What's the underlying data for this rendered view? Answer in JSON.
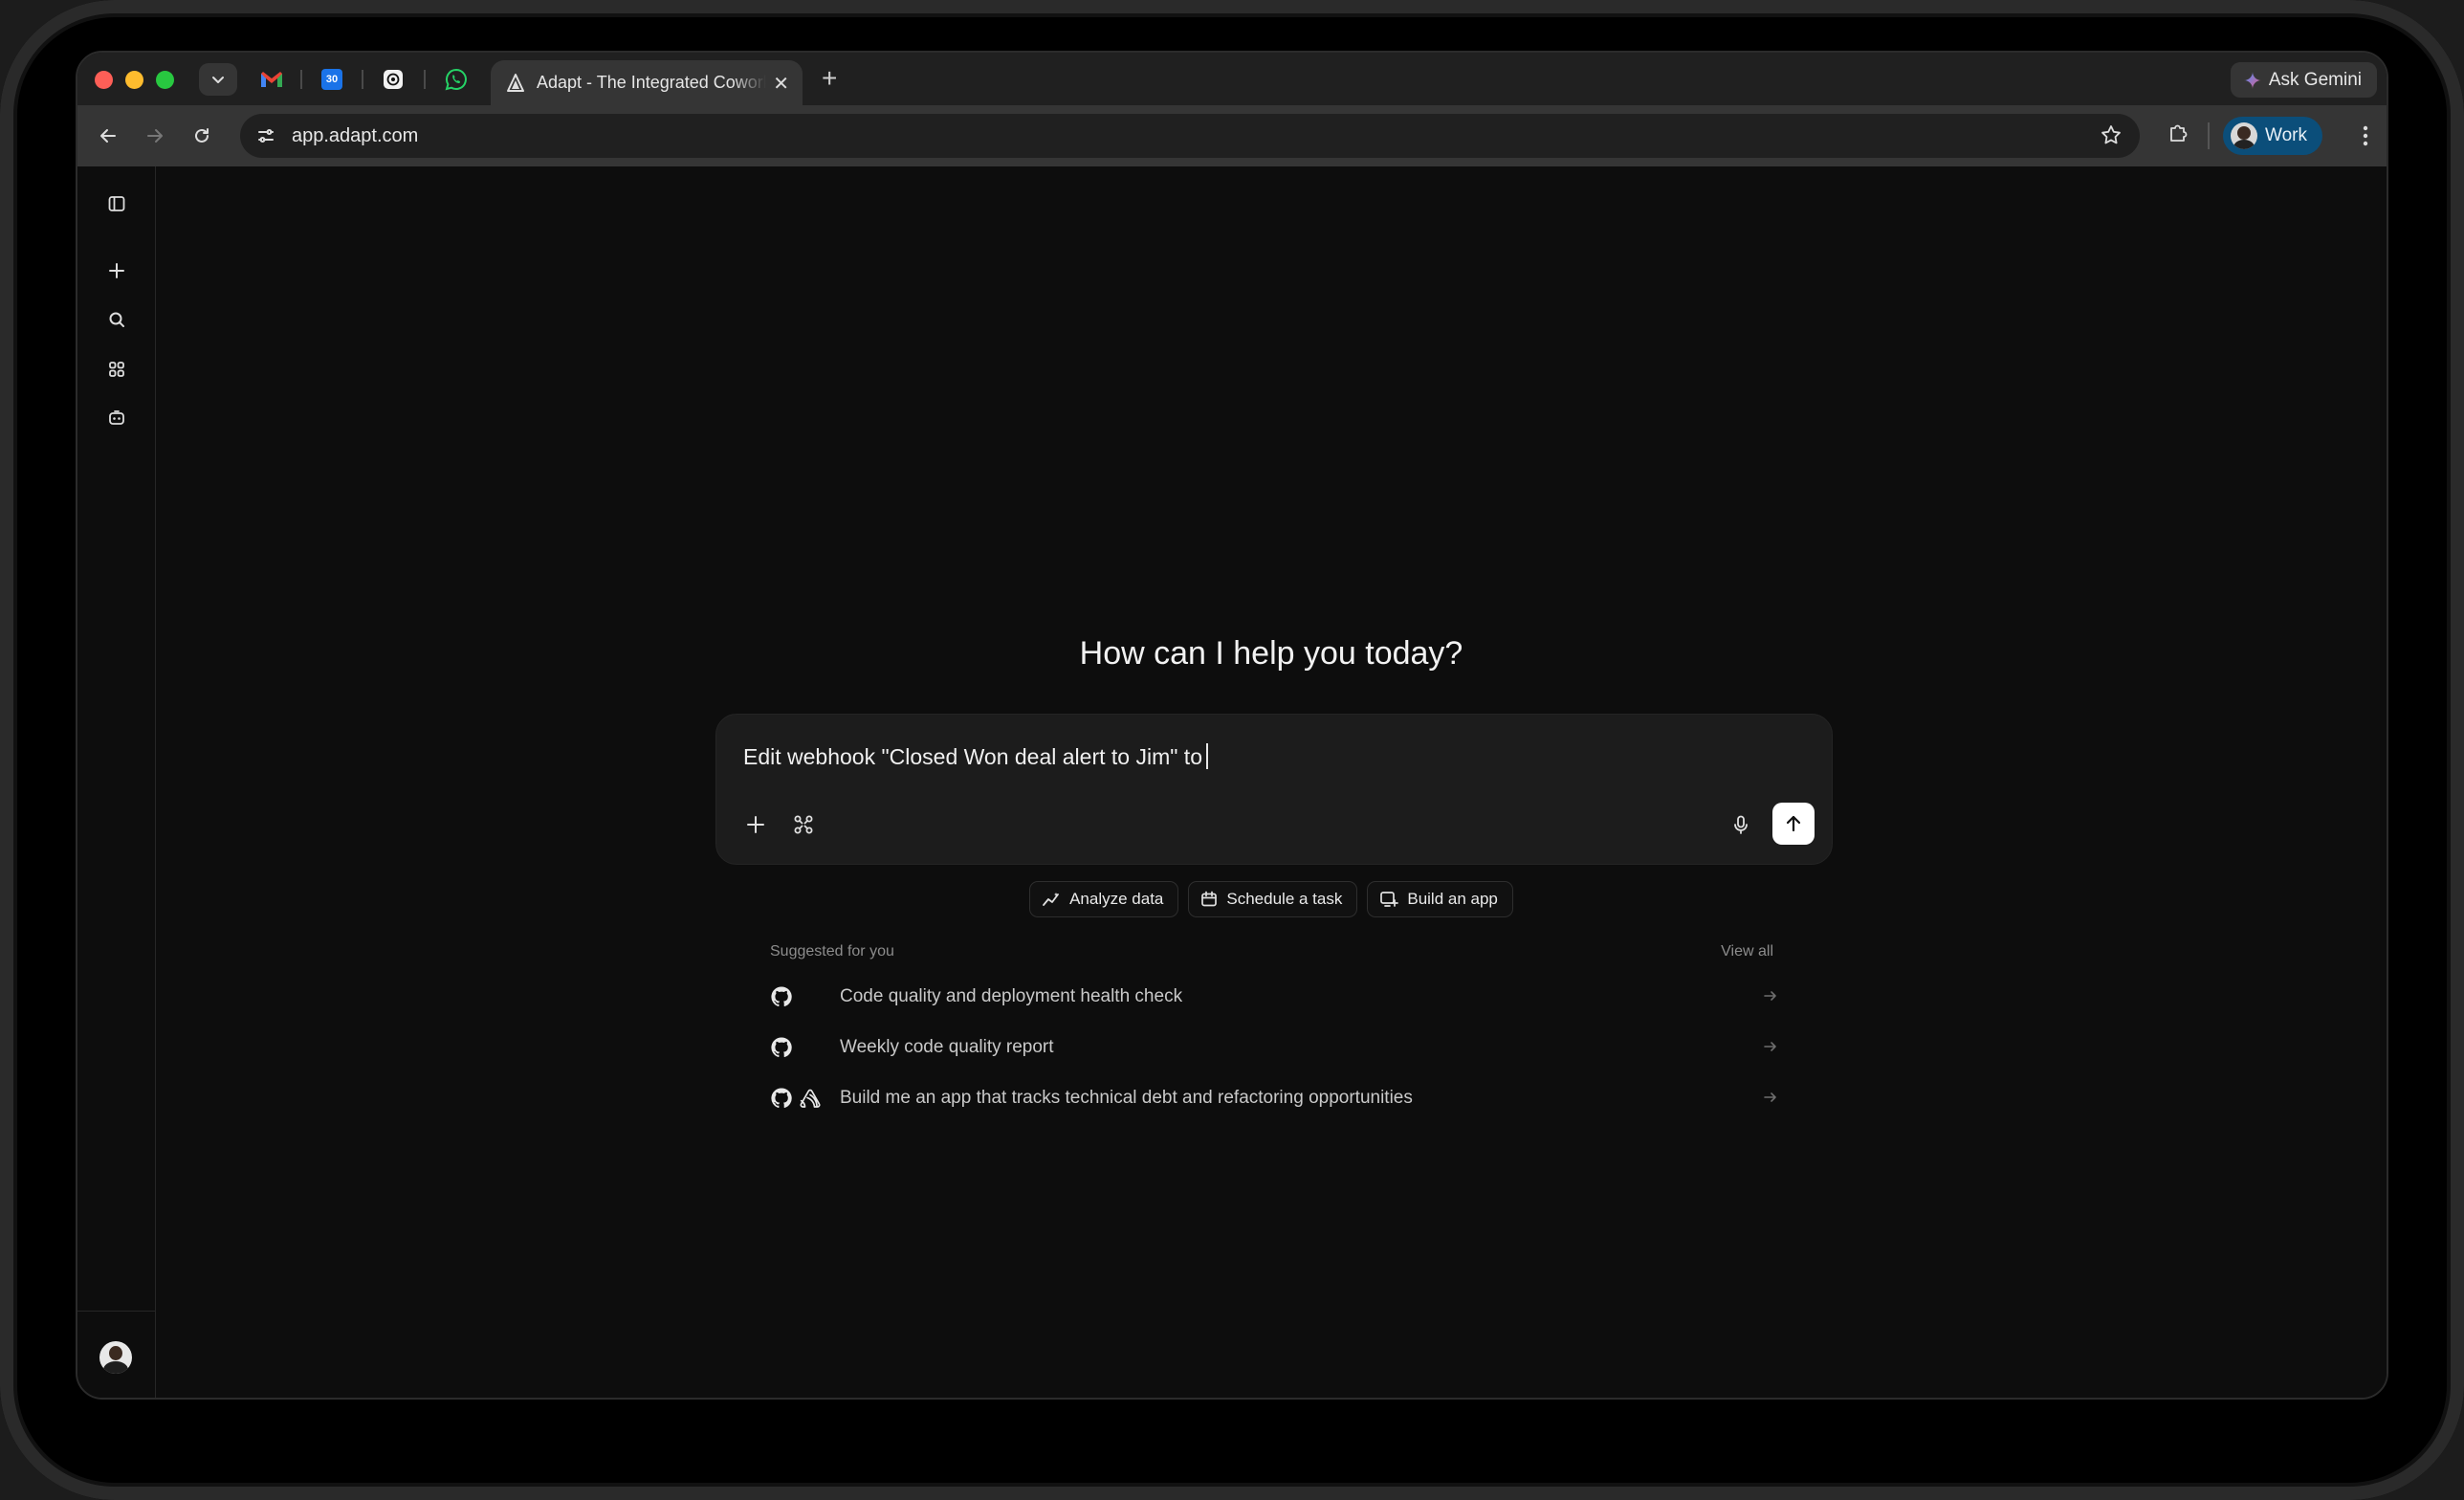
{
  "browser": {
    "active_tab_title": "Adapt - The Integrated Coworker",
    "pinned_tabs": [
      "gmail-icon",
      "calendar-icon",
      "openai-icon",
      "whatsapp-icon"
    ],
    "calendar_day": "30",
    "url": "app.adapt.com",
    "gemini_label": "Ask Gemini",
    "profile_label": "Work"
  },
  "sidebar": {
    "items": [
      "panel-toggle-icon",
      "new-chat-icon",
      "search-icon",
      "apps-icon",
      "agents-icon"
    ]
  },
  "main": {
    "headline": "How can I help you today?",
    "composer_text": "Edit webhook \"Closed Won deal alert to Jim\" to",
    "chips": [
      {
        "label": "Analyze data",
        "icon": "analytics-icon"
      },
      {
        "label": "Schedule a task",
        "icon": "calendar-icon"
      },
      {
        "label": "Build an app",
        "icon": "app-add-icon"
      }
    ],
    "suggested_title": "Suggested for you",
    "view_all": "View all",
    "suggestions": [
      {
        "label": "Code quality and deployment health check",
        "icons": [
          "github-icon"
        ]
      },
      {
        "label": "Weekly code quality report",
        "icons": [
          "github-icon"
        ]
      },
      {
        "label": "Build me an app that tracks technical debt and refactoring opportunities",
        "icons": [
          "github-icon",
          "sentry-icon"
        ]
      }
    ]
  }
}
